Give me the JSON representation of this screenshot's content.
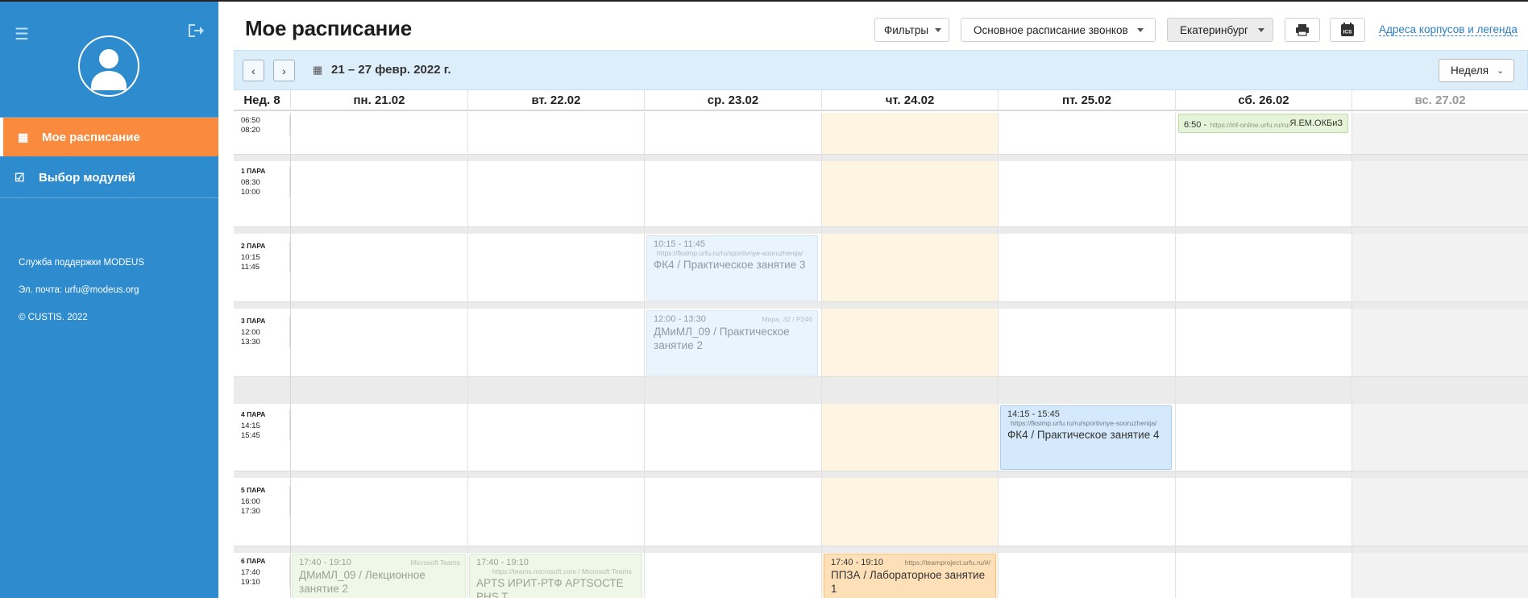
{
  "sidebar": {
    "nav": [
      {
        "label": "Мое расписание",
        "icon": "calendar-icon"
      },
      {
        "label": "Выбор модулей",
        "icon": "checkbox-icon"
      }
    ],
    "support_label": "Служба поддержки MODEUS",
    "email_label": "Эл. почта: urfu@modeus.org",
    "copyright": "© CUSTIS. 2022"
  },
  "header": {
    "title": "Мое расписание",
    "filters_label": "Фильтры",
    "bells_label": "Основное расписание звонков",
    "city_label": "Екатеринбург",
    "ics_label": "ICS",
    "legend_link": "Адреса корпусов и легенда"
  },
  "datebar": {
    "range": "21 – 27 февр. 2022 г.",
    "view": "Неделя"
  },
  "grid": {
    "week_label": "Нед. 8",
    "days": [
      "пн. 21.02",
      "вт. 22.02",
      "ср. 23.02",
      "чт. 24.02",
      "пт. 25.02",
      "сб. 26.02",
      "вс. 27.02"
    ],
    "rows": [
      {
        "pair": "",
        "start": "06:50",
        "end": "08:20"
      },
      {
        "pair": "1 ПАРА",
        "start": "08:30",
        "end": "10:00"
      },
      {
        "pair": "2 ПАРА",
        "start": "10:15",
        "end": "11:45"
      },
      {
        "pair": "3 ПАРА",
        "start": "12:00",
        "end": "13:30"
      },
      {
        "pair": "4 ПАРА",
        "start": "14:15",
        "end": "15:45"
      },
      {
        "pair": "5 ПАРА",
        "start": "16:00",
        "end": "17:30"
      },
      {
        "pair": "6 ПАРА",
        "start": "17:40",
        "end": "19:10"
      }
    ]
  },
  "events": {
    "sat_early": {
      "time": "6:50 -",
      "link": "https://inf-online.urfu.ru/ru/",
      "title": "Я.ЕМ.ОКБиЗ"
    },
    "wed_fk": {
      "time": "10:15 - 11:45",
      "link": "https://fksimp.urfu.ru/ru/sportivnye-sooruzhenija/",
      "title": "ФК4 / Практическое занятие 3"
    },
    "wed_dm": {
      "time": "12:00 - 13:30",
      "place": "Мира, 32 / Р246",
      "title": "ДМиМЛ_09 / Практическое занятие 2"
    },
    "fri_fk": {
      "time": "14:15 - 15:45",
      "link": "https://fksimp.urfu.ru/ru/sportivnye-sooruzhenija/",
      "title": "ФК4 / Практическое занятие 4"
    },
    "mon_dm": {
      "time": "17:40 - 19:10",
      "place": "Microsoft Teams",
      "title": "ДМиМЛ_09 / Лекционное занятие 2"
    },
    "tue_apts": {
      "time": "17:40 - 19:10",
      "link": "https://teams.microsoft.com / Microsoft Teams",
      "title": "APTS ИРИТ-РТФ APTSОСТЕ PHS T..."
    },
    "thu_ppza": {
      "time": "17:40 - 19:10",
      "link": "https://teamproject.urfu.ru/#/",
      "title": "ППЗА / Лабораторное занятие 1"
    }
  }
}
